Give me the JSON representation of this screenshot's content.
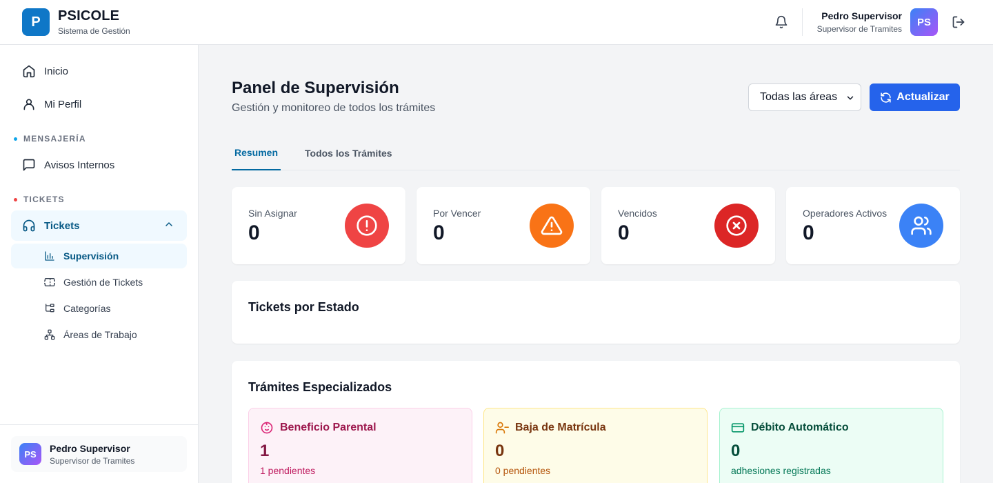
{
  "header": {
    "logo_letter": "P",
    "brand_name": "PSICOLE",
    "brand_sub": "Sistema de Gestión",
    "user_name": "Pedro Supervisor",
    "user_role": "Supervisor de Tramites",
    "user_initials": "PS"
  },
  "sidebar": {
    "items": [
      {
        "label": "Inicio",
        "icon": "home-icon"
      },
      {
        "label": "Mi Perfil",
        "icon": "user-icon"
      }
    ],
    "sections": [
      {
        "label": "MENSAJERÍA",
        "color": "#0ea5e9"
      },
      {
        "label": "TICKETS",
        "color": "#ef4444"
      }
    ],
    "avisos_label": "Avisos Internos",
    "tickets_label": "Tickets",
    "sub_items": [
      {
        "label": "Supervisión",
        "icon": "bar-chart-icon"
      },
      {
        "label": "Gestión de Tickets",
        "icon": "ticket-icon"
      },
      {
        "label": "Categorías",
        "icon": "tree-icon"
      },
      {
        "label": "Áreas de Trabajo",
        "icon": "network-icon"
      }
    ],
    "user_name": "Pedro Supervisor",
    "user_role": "Supervisor de Tramites",
    "user_initials": "PS"
  },
  "main": {
    "title": "Panel de Supervisión",
    "subtitle": "Gestión y monitoreo de todos los trámites",
    "area_select_value": "Todas las áreas",
    "refresh_label": "Actualizar",
    "tabs": [
      {
        "label": "Resumen",
        "active": true
      },
      {
        "label": "Todos los Trámites",
        "active": false
      }
    ],
    "stats": [
      {
        "label": "Sin Asignar",
        "value": "0",
        "color": "#ef4444",
        "icon": "alert-circle-icon"
      },
      {
        "label": "Por Vencer",
        "value": "0",
        "color": "#f97316",
        "icon": "warning-triangle-icon"
      },
      {
        "label": "Vencidos",
        "value": "0",
        "color": "#dc2626",
        "icon": "x-circle-icon"
      },
      {
        "label": "Operadores Activos",
        "value": "0",
        "color": "#3b82f6",
        "icon": "users-icon"
      }
    ],
    "tickets_por_estado_title": "Tickets por Estado",
    "tramites_title": "Trámites Especializados",
    "tramites": [
      {
        "title": "Beneficio Parental",
        "value": "1",
        "sub": "1 pendientes",
        "bg": "#fdf2f8",
        "border": "#fbcfe8",
        "color": "#9d174d",
        "accent": "#db2777",
        "icon": "baby-face-icon"
      },
      {
        "title": "Baja de Matrícula",
        "value": "0",
        "sub": "0 pendientes",
        "bg": "#fefce8",
        "border": "#fde68a",
        "color": "#92400e",
        "accent": "#d97706",
        "icon": "user-minus-icon"
      },
      {
        "title": "Débito Automático",
        "value": "0",
        "sub": "adhesiones registradas",
        "bg": "#ecfdf5",
        "border": "#a7f3d0",
        "color": "#065f46",
        "accent": "#059669",
        "icon": "credit-card-icon"
      }
    ]
  }
}
